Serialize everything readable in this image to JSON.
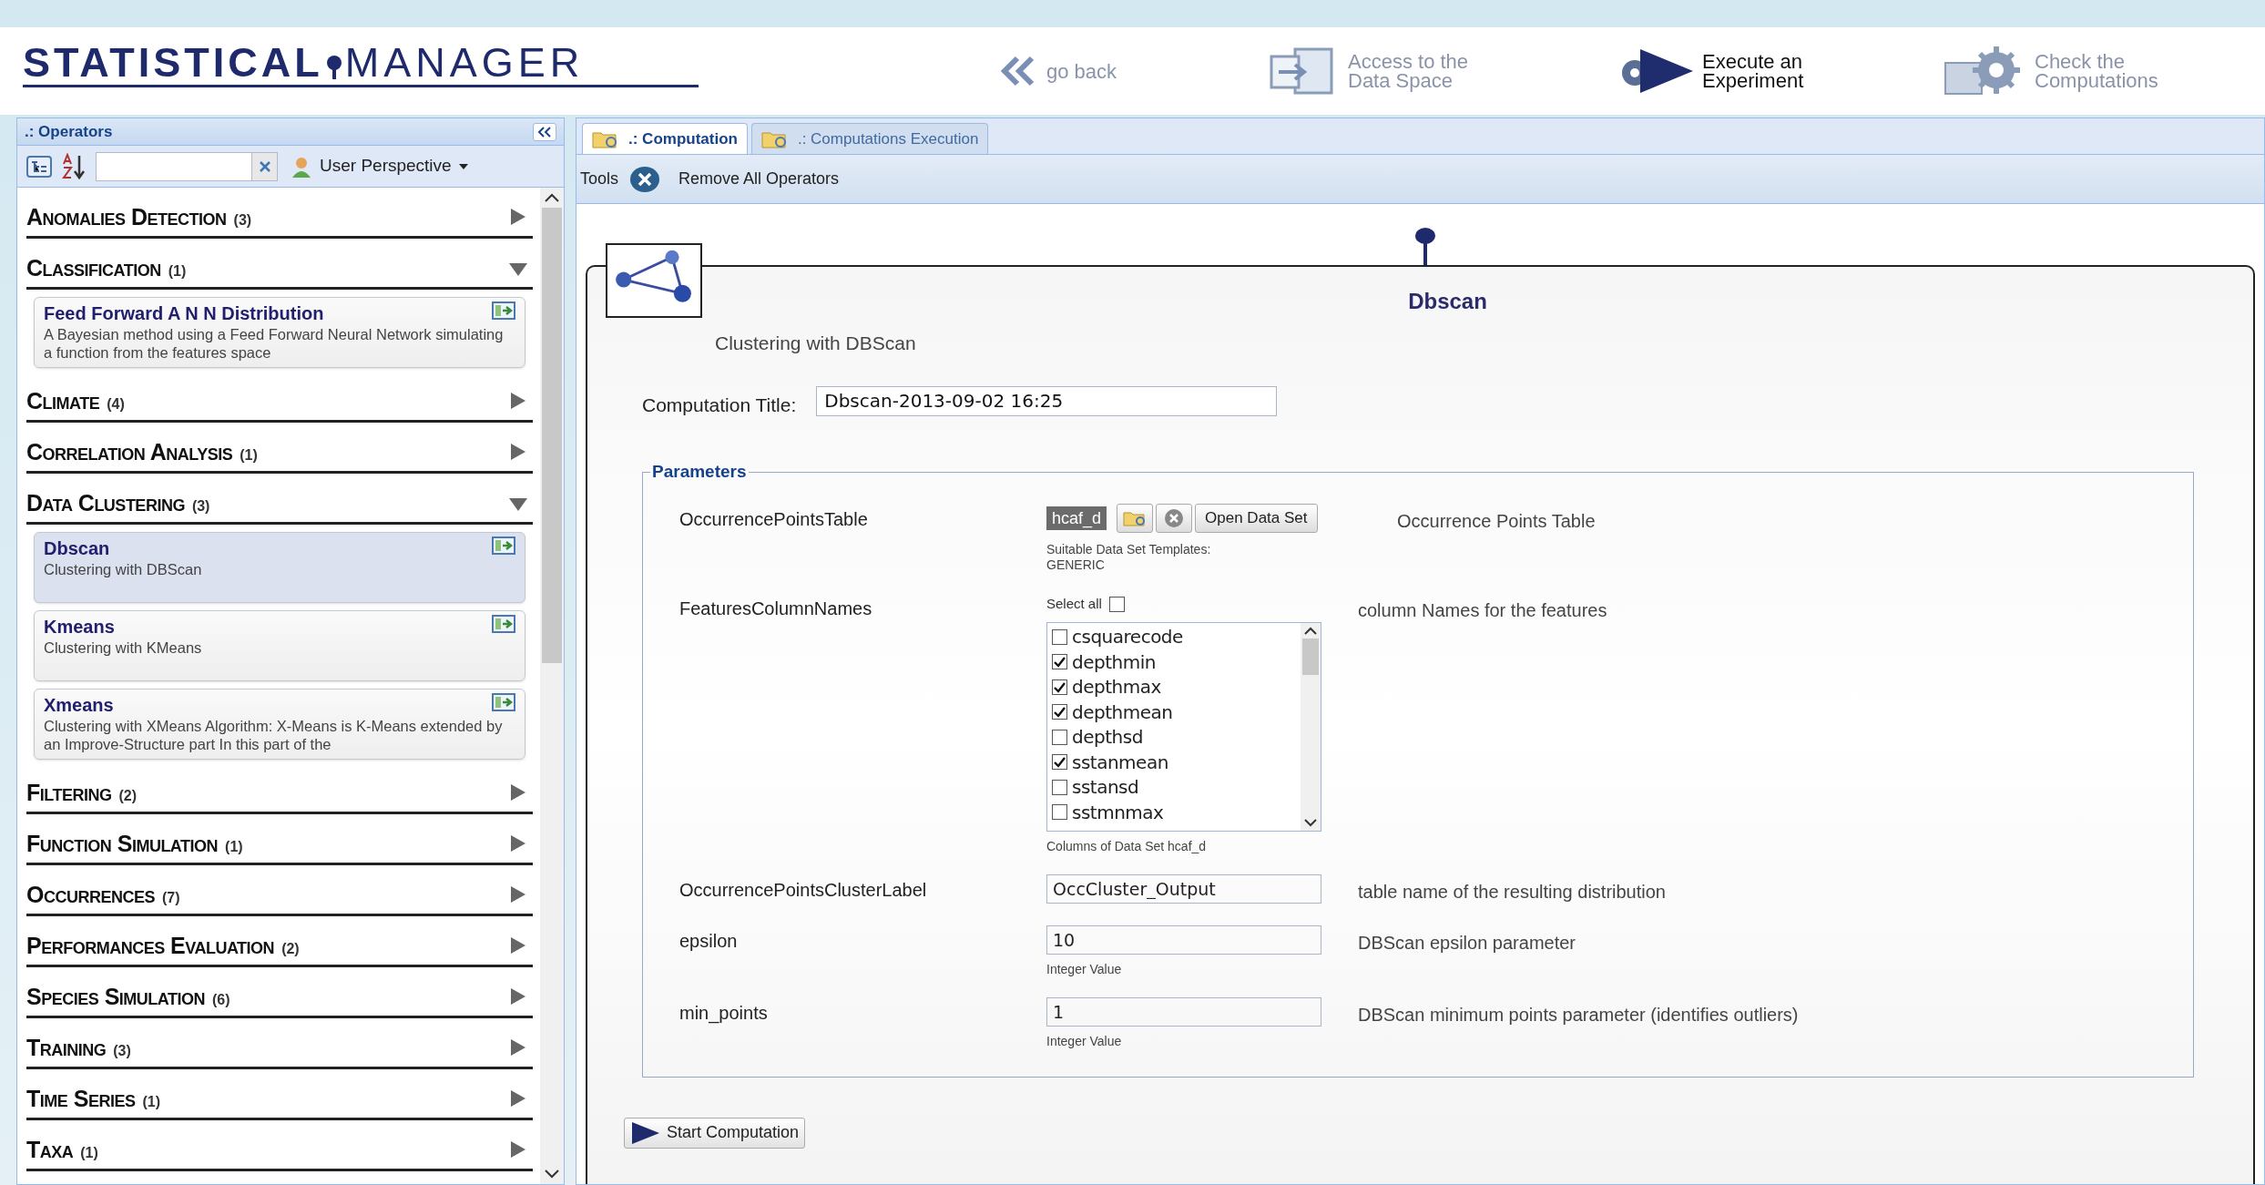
{
  "logo": [
    "STATISTICAL",
    "MANAGER"
  ],
  "nav": [
    {
      "kind": "back",
      "lines": [
        "go back"
      ]
    },
    {
      "kind": "data",
      "lines": [
        "Access to the",
        "Data Space"
      ]
    },
    {
      "kind": "execute",
      "lines": [
        "Execute an",
        "Experiment"
      ]
    },
    {
      "kind": "check",
      "lines": [
        "Check the",
        "Computations"
      ]
    }
  ],
  "operators_panel": {
    "title": ".: Operators",
    "perspective": "User Perspective",
    "categories": [
      {
        "name": "Anomalies Detection",
        "count": "(3)",
        "expanded": false
      },
      {
        "name": "Classification",
        "count": "(1)",
        "expanded": true,
        "operators": [
          {
            "title": "Feed Forward A N N Distribution",
            "description": "A Bayesian method using a Feed Forward Neural Network simulating a function from the features space",
            "selected": false
          }
        ]
      },
      {
        "name": "Climate",
        "count": "(4)",
        "expanded": false
      },
      {
        "name": "Correlation Analysis",
        "count": "(1)",
        "expanded": false
      },
      {
        "name": "Data Clustering",
        "count": "(3)",
        "expanded": true,
        "operators": [
          {
            "title": "Dbscan",
            "description": "Clustering with DBScan",
            "selected": true
          },
          {
            "title": "Kmeans",
            "description": "Clustering with KMeans",
            "selected": false
          },
          {
            "title": "Xmeans",
            "description": "Clustering with XMeans Algorithm: X-Means is K-Means extended by an Improve-Structure part In this part of the",
            "selected": false
          }
        ]
      },
      {
        "name": "Filtering",
        "count": "(2)",
        "expanded": false
      },
      {
        "name": "Function Simulation",
        "count": "(1)",
        "expanded": false
      },
      {
        "name": "Occurrences",
        "count": "(7)",
        "expanded": false
      },
      {
        "name": "Performances Evaluation",
        "count": "(2)",
        "expanded": false
      },
      {
        "name": "Species Simulation",
        "count": "(6)",
        "expanded": false
      },
      {
        "name": "Training",
        "count": "(3)",
        "expanded": false
      },
      {
        "name": "Time Series",
        "count": "(1)",
        "expanded": false
      },
      {
        "name": "Taxa",
        "count": "(1)",
        "expanded": false
      }
    ]
  },
  "tabs": [
    {
      "label": ".: Computation",
      "selected": true
    },
    {
      "label": ".: Computations Execution",
      "selected": false
    }
  ],
  "toolbar": {
    "label": "Tools",
    "action": "Remove All Operators"
  },
  "operator": {
    "title": "Dbscan",
    "description": "Clustering with DBScan",
    "computation_title_label": "Computation Title:",
    "computation_title": "Dbscan-2013-09-02 16:25",
    "parameters_legend": "Parameters",
    "start_button": "Start Computation",
    "parameters": [
      {
        "kind": "table",
        "name": "OccurrencePointsTable",
        "value": "hcaf_d",
        "button": "Open Data Set",
        "notes": [
          "Suitable Data Set Templates:",
          "GENERIC"
        ],
        "description": "Occurrence Points Table"
      },
      {
        "kind": "columns",
        "name": "FeaturesColumnNames",
        "select_all": "Select all",
        "select_all_checked": false,
        "columns": [
          {
            "name": "csquarecode",
            "checked": false
          },
          {
            "name": "depthmin",
            "checked": true
          },
          {
            "name": "depthmax",
            "checked": true
          },
          {
            "name": "depthmean",
            "checked": true
          },
          {
            "name": "depthsd",
            "checked": false
          },
          {
            "name": "sstanmean",
            "checked": true
          },
          {
            "name": "sstansd",
            "checked": false
          },
          {
            "name": "sstmnmax",
            "checked": false
          }
        ],
        "notes": [
          "Columns of Data Set hcaf_d"
        ],
        "description": "column Names for the features"
      },
      {
        "kind": "text",
        "name": "OccurrencePointsClusterLabel",
        "value": "OccCluster_Output",
        "description": "table name of the resulting distribution"
      },
      {
        "kind": "number",
        "name": "epsilon",
        "value": "10",
        "notes": [
          "Integer Value"
        ],
        "description": "DBScan epsilon parameter"
      },
      {
        "kind": "number",
        "name": "min_points",
        "value": "1",
        "notes": [
          "Integer Value"
        ],
        "description": "DBScan minimum points parameter (identifies outliers)"
      }
    ]
  }
}
